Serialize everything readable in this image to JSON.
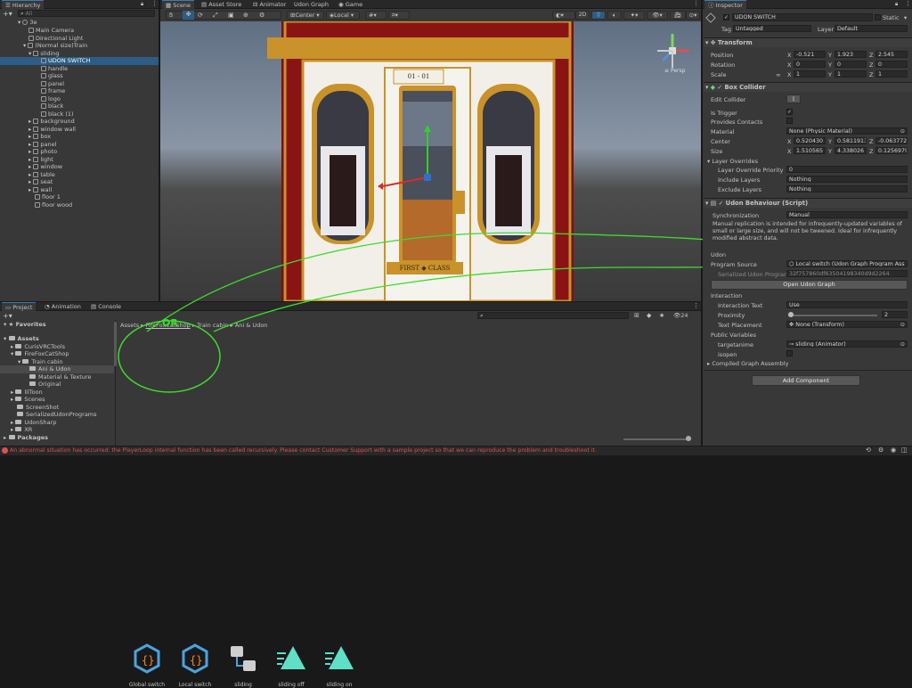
{
  "hierarchy": {
    "tab": "Hierarchy",
    "search_placeholder": "All",
    "items": [
      {
        "label": "3e"
      },
      {
        "label": "Main Camera"
      },
      {
        "label": "Directional Light"
      },
      {
        "label": "(Normal size)Train"
      },
      {
        "label": "sliding"
      },
      {
        "label": "UDON SWITCH"
      },
      {
        "label": "handle"
      },
      {
        "label": "glass"
      },
      {
        "label": "panel"
      },
      {
        "label": "frame"
      },
      {
        "label": "logo"
      },
      {
        "label": "black"
      },
      {
        "label": "black (1)"
      },
      {
        "label": "background"
      },
      {
        "label": "window wall"
      },
      {
        "label": "box"
      },
      {
        "label": "panel"
      },
      {
        "label": "photo"
      },
      {
        "label": "light"
      },
      {
        "label": "window"
      },
      {
        "label": "table"
      },
      {
        "label": "seat"
      },
      {
        "label": "wall"
      },
      {
        "label": "floor 1"
      },
      {
        "label": "floor wood"
      }
    ]
  },
  "scene_tabs": [
    "Scene",
    "Asset Store",
    "Animator",
    "Udon Graph",
    "Game"
  ],
  "scene_toolbar": {
    "pivot": "Center",
    "space": "Local",
    "mode_2d": "2D",
    "persp": "Persp"
  },
  "scene_view": {
    "plate_top": "01 - 01",
    "plate_bottom": "FIRST ◆ CLASS"
  },
  "bottom_tabs": [
    "Project",
    "Animation",
    "Console"
  ],
  "project": {
    "favorites": "Favorites",
    "assets_root": "Assets",
    "folders": [
      {
        "label": "CurisVRCTools"
      },
      {
        "label": "FireFoxCatShop"
      },
      {
        "label": "Train cabin"
      },
      {
        "label": "Ani & Udon"
      },
      {
        "label": "Material & Texture"
      },
      {
        "label": "Original"
      },
      {
        "label": "lilToon"
      },
      {
        "label": "Scenes"
      },
      {
        "label": "ScreenShot"
      },
      {
        "label": "SerializedUdonPrograms"
      },
      {
        "label": "UdonSharp"
      },
      {
        "label": "XR"
      }
    ],
    "packages": "Packages",
    "breadcrumb": [
      "Assets",
      "FireFoxCatShop",
      "Train cabin",
      "Ani & Udon"
    ],
    "hidden_count": "24",
    "assets": [
      {
        "label": "Global switch"
      },
      {
        "label": "Local switch"
      },
      {
        "label": "sliding"
      },
      {
        "label": "sliding off"
      },
      {
        "label": "sliding on"
      }
    ],
    "annotation": "OR"
  },
  "inspector": {
    "tab": "Inspector",
    "object_name": "UDON SWITCH",
    "static_label": "Static",
    "tag_label": "Tag",
    "tag_value": "Untagged",
    "layer_label": "Layer",
    "layer_value": "Default",
    "transform": {
      "title": "Transform",
      "position_label": "Position",
      "position": [
        "-0.521",
        "1.923",
        "2.545"
      ],
      "rotation_label": "Rotation",
      "rotation": [
        "0",
        "0",
        "0"
      ],
      "scale_label": "Scale",
      "scale": [
        "1",
        "1",
        "1"
      ],
      "scale_link": "∞"
    },
    "box_collider": {
      "title": "Box Collider",
      "edit_collider": "Edit Collider",
      "is_trigger": "Is Trigger",
      "provides_contacts": "Provides Contacts",
      "material_label": "Material",
      "material_value": "None (Physic Material)",
      "center_label": "Center",
      "center": [
        "0.520430",
        "0.5811913",
        "-0.063772"
      ],
      "size_label": "Size",
      "size": [
        "1.510565",
        "4.338026",
        "0.1256979"
      ],
      "layer_overrides": "Layer Overrides",
      "layer_override_priority": "Layer Override Priority",
      "layer_override_priority_value": "0",
      "include_layers": "Include Layers",
      "include_value": "Nothing",
      "exclude_layers": "Exclude Layers",
      "exclude_value": "Nothing"
    },
    "udon_behaviour": {
      "title": "Udon Behaviour (Script)",
      "sync_label": "Synchronization",
      "sync_value": "Manual",
      "sync_help": "Manual replication is intended for infrequently-updated variables of small or large size, and will not be tweened. Ideal for infrequently modified abstract data.",
      "udon_label": "Udon",
      "program_source_label": "Program Source",
      "program_source_value": "Local switch (Udon Graph Program Ass",
      "serialized_label": "Serialized Udon Program",
      "serialized_value": "32f757860df63504198340d9d2264",
      "open_graph": "Open Udon Graph",
      "interaction": "Interaction",
      "interaction_text_label": "Interaction Text",
      "interaction_text_value": "Use",
      "proximity_label": "Proximity",
      "proximity_value": "2",
      "text_placement_label": "Text Placement",
      "text_placement_value": "None (Transform)",
      "public_variables": "Public Variables",
      "targetanime_label": "targetanime",
      "targetanime_value": "sliding (Animator)",
      "isopen_label": "isopen",
      "compiled_graph": "Compiled Graph Assembly"
    },
    "add_component": "Add Component"
  },
  "status_bar": {
    "message": "An abnormal situation has occurred: the PlayerLoop internal function has been called recursively. Please contact Customer Support with a sample project so that we can reproduce the problem and troubleshoot it."
  },
  "colors": {
    "accent": "#3a79bb",
    "selection": "#2c5d87",
    "annotation": "#3ddc2c",
    "error": "#e05050"
  }
}
